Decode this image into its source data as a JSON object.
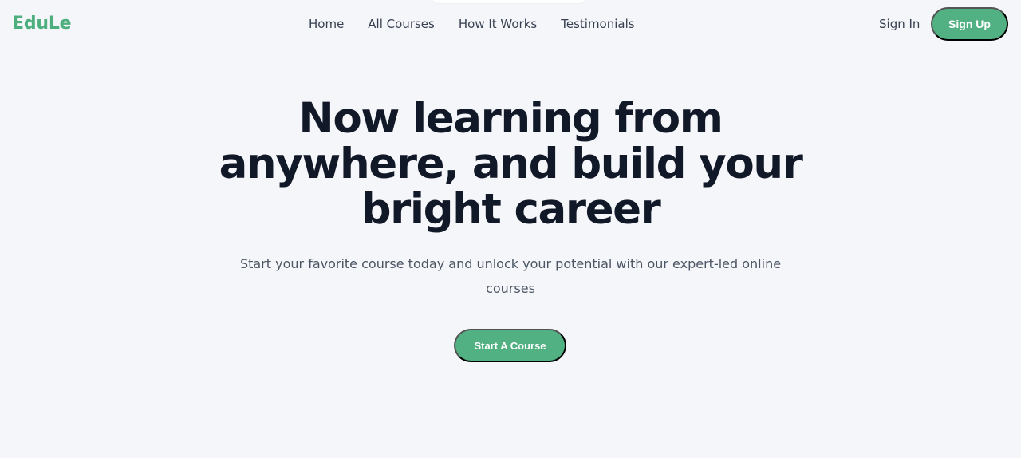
{
  "brand": {
    "name": "EduLe",
    "color": "#4caf7d"
  },
  "nav": {
    "links": [
      {
        "label": "Home"
      },
      {
        "label": "All Courses"
      },
      {
        "label": "How It Works"
      },
      {
        "label": "Testimonials"
      }
    ],
    "sign_in_label": "Sign In",
    "sign_up_label": "Sign Up"
  },
  "hero": {
    "title": "Now learning from anywhere, and build your bright career",
    "subtitle": "Start your favorite course today and unlock your potential with our expert-led online courses",
    "cta_label": "Start A Course"
  },
  "colors": {
    "background": "#f5f6fa",
    "accent": "#52b183",
    "heading": "#111827",
    "body_text": "#4b5563"
  }
}
